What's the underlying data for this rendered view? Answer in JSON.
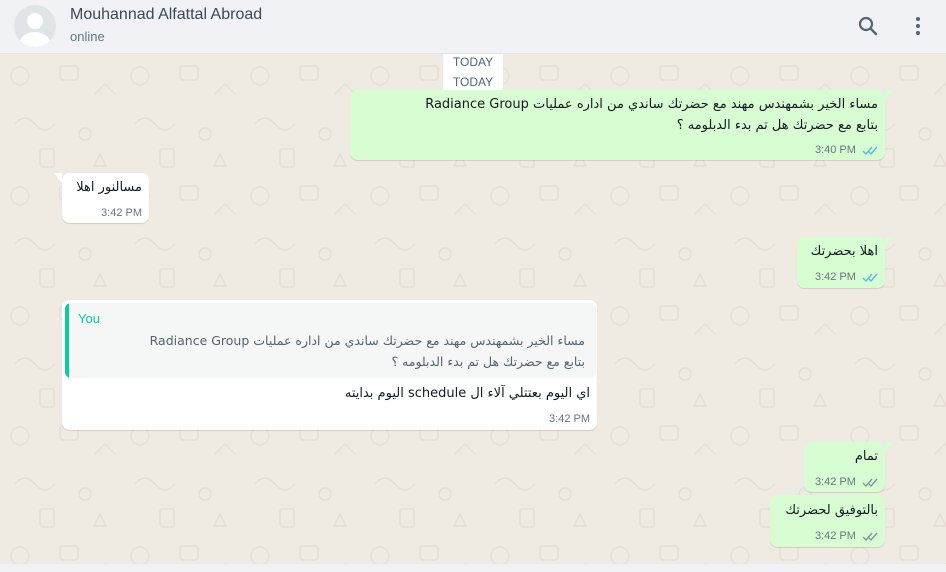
{
  "header": {
    "contact_name": "Mouhannad Alfattal Abroad",
    "status": "online"
  },
  "chat": {
    "date_labels": [
      "TODAY",
      "TODAY"
    ],
    "messages": [
      {
        "direction": "out",
        "lines": [
          "مساء الخير بشمهندس مهند مع حضرتك ساندي من اداره عمليات Radiance Group",
          "بتابع مع حضرتك هل تم بدء الدبلومه ؟"
        ],
        "time": "3:40 PM",
        "status": "read"
      },
      {
        "direction": "in",
        "lines": [
          "مسالنور اهلا"
        ],
        "time": "3:42 PM"
      },
      {
        "direction": "out",
        "lines": [
          "اهلا بحضرتك"
        ],
        "time": "3:42 PM",
        "status": "read"
      },
      {
        "direction": "in",
        "quoted": {
          "author": "You",
          "lines": [
            "مساء الخير بشمهندس مهند مع حضرتك ساندي من اداره عمليات Radiance Group",
            "بتابع مع حضرتك هل تم بدء الدبلومه ؟"
          ]
        },
        "lines": [
          "اي اليوم بعتتلي آلاء ال schedule اليوم بدايته"
        ],
        "time": "3:42 PM"
      },
      {
        "direction": "out",
        "lines": [
          "تمام"
        ],
        "time": "3:42 PM",
        "status": "delivered"
      },
      {
        "direction": "out",
        "lines": [
          "بالتوفيق لحضرتك"
        ],
        "time": "3:42 PM",
        "status": "delivered"
      }
    ]
  },
  "icons": {
    "search": "search-icon",
    "menu": "kebab-menu-icon",
    "avatar": "default-avatar-icon",
    "read_receipt": "double-check-icon"
  },
  "colors": {
    "outgoing_bubble": "#d9fdd3",
    "incoming_bubble": "#ffffff",
    "chat_background": "#efeae2",
    "read_tick": "#53bdeb",
    "delivered_tick": "#8696a0",
    "quote_accent": "#06cf9c"
  }
}
